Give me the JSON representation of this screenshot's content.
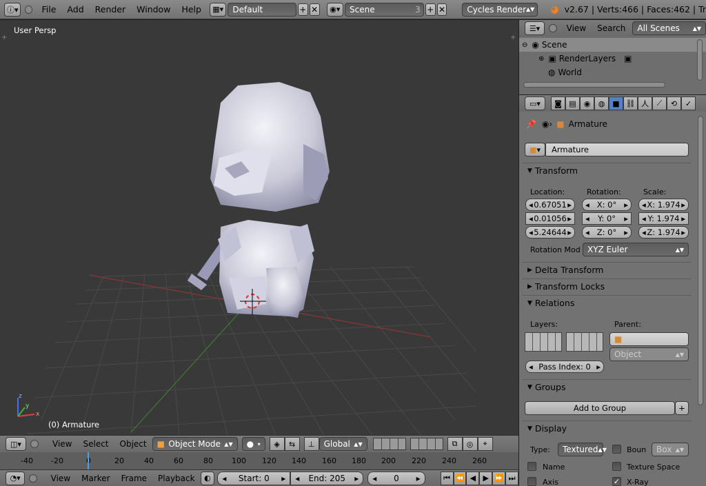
{
  "topbar": {
    "menus": [
      "File",
      "Add",
      "Render",
      "Window",
      "Help"
    ],
    "screen_layout": "Default",
    "scene_name": "Scene",
    "scene_count": "3",
    "render_engine": "Cycles Render",
    "stats": "v2.67 | Verts:466 | Faces:462 | Tr"
  },
  "viewport": {
    "view_label": "User Persp",
    "object_label": "(0) Armature",
    "axes": {
      "x": "x",
      "y": "y",
      "z": "z"
    },
    "header": {
      "menus": [
        "View",
        "Select",
        "Object"
      ],
      "mode": "Object Mode",
      "orientation": "Global"
    }
  },
  "timeline": {
    "ticks": [
      "-40",
      "-20",
      "0",
      "20",
      "40",
      "60",
      "80",
      "100",
      "120",
      "140",
      "160",
      "180",
      "200",
      "220",
      "240",
      "260"
    ],
    "header": {
      "menus": [
        "View",
        "Marker",
        "Frame",
        "Playback"
      ],
      "start": "Start: 0",
      "end": "End: 205",
      "current": "0"
    }
  },
  "outliner": {
    "header": {
      "view": "View",
      "search": "Search",
      "filter": "All Scenes"
    },
    "items": [
      {
        "label": "Scene"
      },
      {
        "label": "RenderLayers"
      },
      {
        "label": "World"
      }
    ]
  },
  "properties": {
    "breadcrumb": "Armature",
    "object_name": "Armature",
    "transform": {
      "title": "Transform",
      "location_label": "Location:",
      "rotation_label": "Rotation:",
      "scale_label": "Scale:",
      "location": [
        "0.67051",
        "0.01056",
        "5.24644"
      ],
      "rotation": [
        "X: 0°",
        "Y: 0°",
        "Z: 0°"
      ],
      "scale": [
        "X: 1.974",
        "Y: 1.974",
        "Z: 1.974"
      ],
      "rotation_mode_label": "Rotation Mod",
      "rotation_mode": "XYZ Euler"
    },
    "delta_transform": "Delta Transform",
    "transform_locks": "Transform Locks",
    "relations": {
      "title": "Relations",
      "layers_label": "Layers:",
      "parent_label": "Parent:",
      "parent_type": "Object",
      "pass_index": "Pass Index: 0"
    },
    "groups": {
      "title": "Groups",
      "add_button": "Add to Group"
    },
    "display": {
      "title": "Display",
      "type_label": "Type:",
      "type_value": "Textured",
      "bounds_label": "Boun",
      "bounds_value": "Box",
      "name_label": "Name",
      "texture_space_label": "Texture Space",
      "axis_label": "Axis",
      "xray_label": "X-Ray"
    }
  },
  "colors": {
    "viewport_bg": "#393939",
    "panel_bg": "#727272",
    "accent_blue": "#5680c2"
  }
}
